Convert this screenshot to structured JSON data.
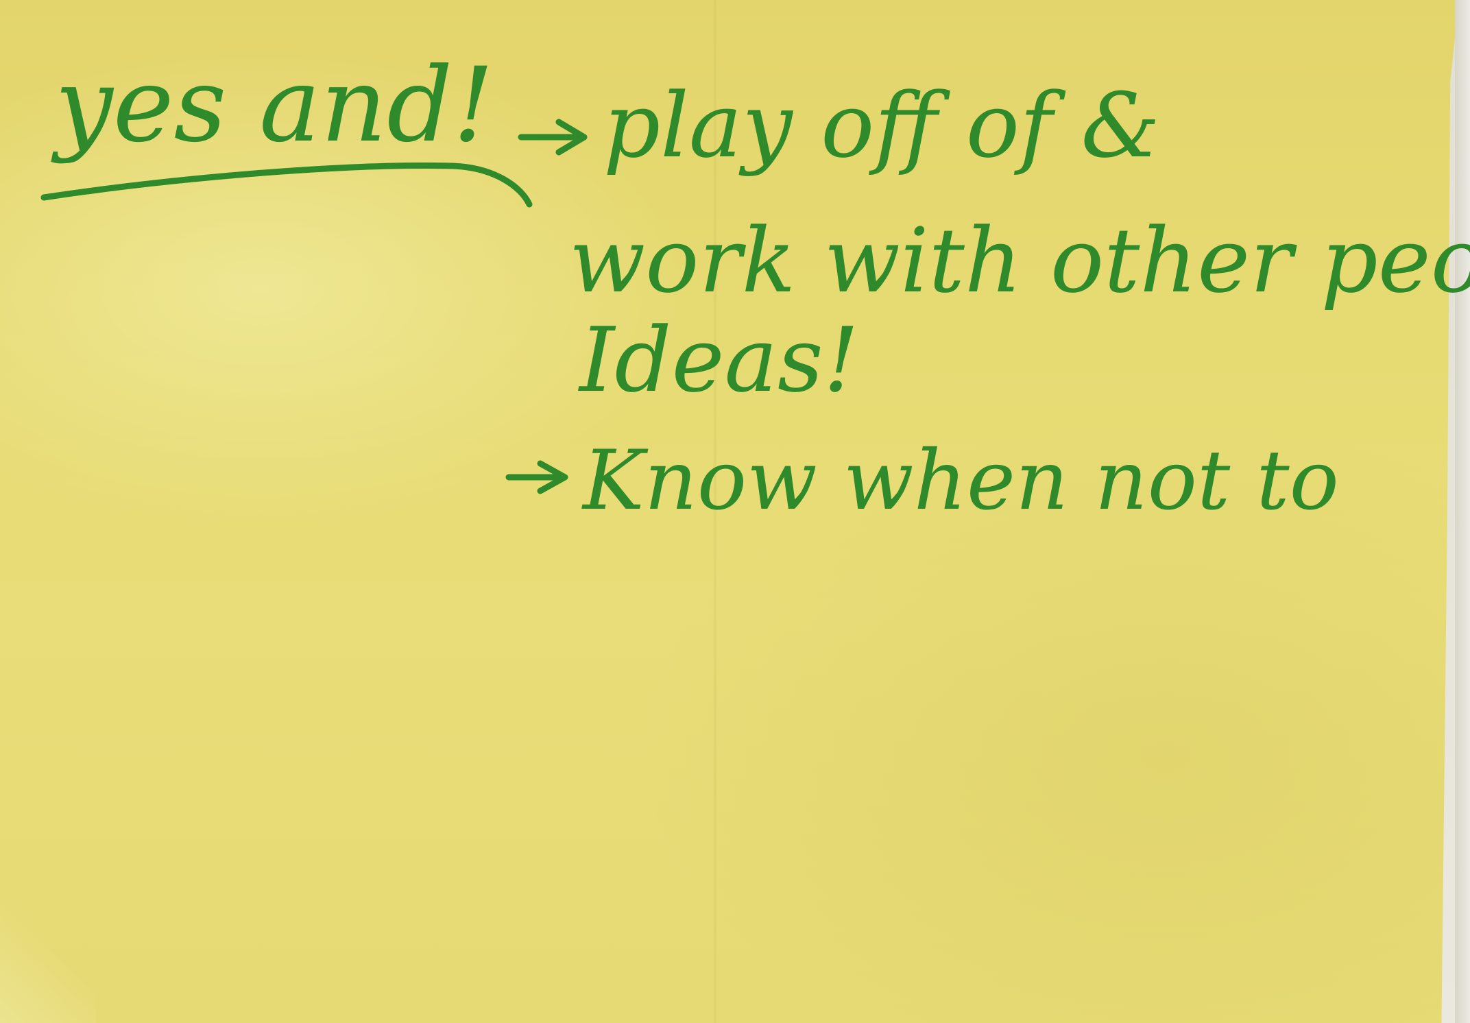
{
  "note": {
    "paper_color": "#e6da72",
    "ink_color": "#2e8a2a",
    "heading": "yes and!",
    "lines": [
      "play off of &",
      "work with other people's",
      "Ideas!",
      "Know when not to"
    ]
  }
}
